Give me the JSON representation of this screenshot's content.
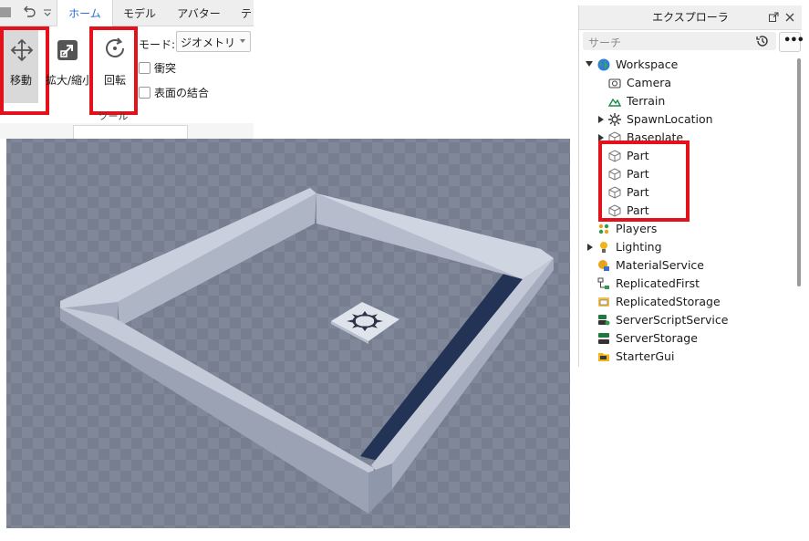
{
  "ribbon": {
    "tabs": [
      {
        "label": "ホーム",
        "active": true
      },
      {
        "label": "モデル"
      },
      {
        "label": "アバター"
      },
      {
        "label": "テ"
      }
    ],
    "move_label": "移動",
    "scale_label": "拡大/縮小",
    "rotate_label": "回転",
    "mode_label": "モード:",
    "mode_value": "ジオメトリ",
    "collision_label": "衝突",
    "join_label": "表面の結合",
    "group_label": "ツール"
  },
  "explorer": {
    "title": "エクスプローラ",
    "search_placeholder": "サーチ",
    "items": [
      {
        "label": "Workspace",
        "icon": "globe-icon",
        "depth": 0,
        "expander": "down"
      },
      {
        "label": "Camera",
        "icon": "camera-icon",
        "depth": 1,
        "expander": ""
      },
      {
        "label": "Terrain",
        "icon": "terrain-icon",
        "depth": 1,
        "expander": ""
      },
      {
        "label": "SpawnLocation",
        "icon": "spawn-icon",
        "depth": 1,
        "expander": "right"
      },
      {
        "label": "Baseplate",
        "icon": "part-icon",
        "depth": 1,
        "expander": "right"
      },
      {
        "label": "Part",
        "icon": "part-icon",
        "depth": 1,
        "expander": ""
      },
      {
        "label": "Part",
        "icon": "part-icon",
        "depth": 1,
        "expander": ""
      },
      {
        "label": "Part",
        "icon": "part-icon",
        "depth": 1,
        "expander": ""
      },
      {
        "label": "Part",
        "icon": "part-icon",
        "depth": 1,
        "expander": ""
      },
      {
        "label": "Players",
        "icon": "players-icon",
        "depth": 0,
        "expander": ""
      },
      {
        "label": "Lighting",
        "icon": "lightbulb-icon",
        "depth": 0,
        "expander": "right"
      },
      {
        "label": "MaterialService",
        "icon": "material-icon",
        "depth": 0,
        "expander": ""
      },
      {
        "label": "ReplicatedFirst",
        "icon": "replicated-first-icon",
        "depth": 0,
        "expander": ""
      },
      {
        "label": "ReplicatedStorage",
        "icon": "replicated-storage-icon",
        "depth": 0,
        "expander": ""
      },
      {
        "label": "ServerScriptService",
        "icon": "server-script-icon",
        "depth": 0,
        "expander": ""
      },
      {
        "label": "ServerStorage",
        "icon": "server-storage-icon",
        "depth": 0,
        "expander": ""
      },
      {
        "label": "StarterGui",
        "icon": "folder-icon",
        "depth": 0,
        "expander": ""
      }
    ]
  },
  "colors": {
    "highlight": "#e3111b",
    "accent": "#2a6fd6",
    "wall": "#bcc3d3",
    "floor": "#7d8597"
  }
}
